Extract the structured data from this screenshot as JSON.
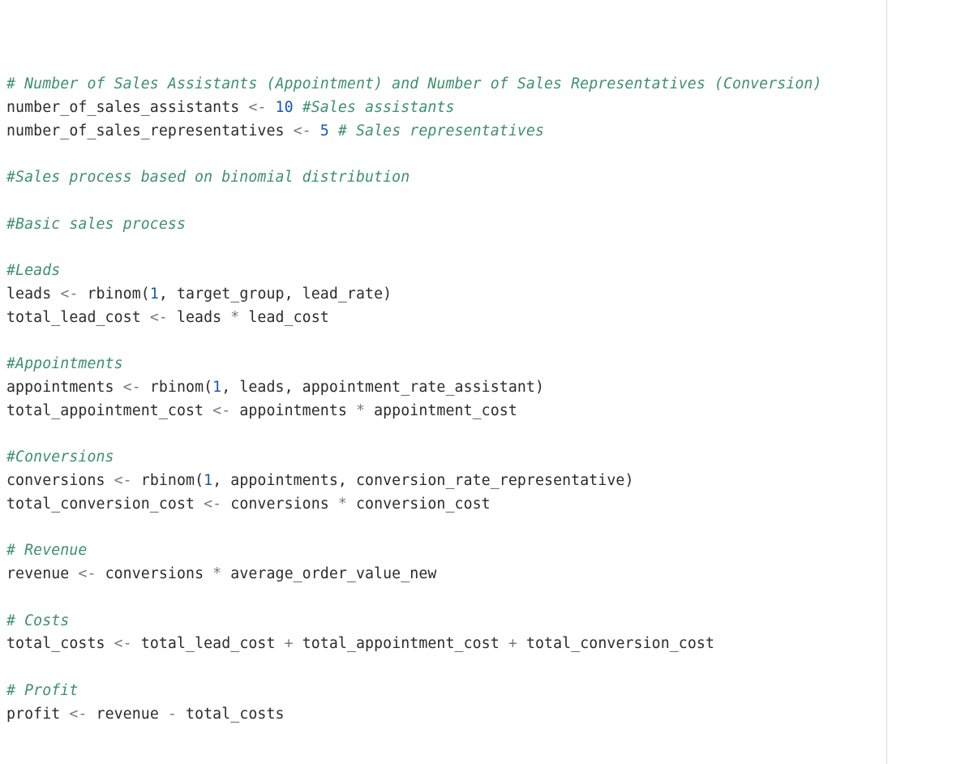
{
  "code": {
    "colors": {
      "comment": "#3d8f70",
      "operator": "#7a7a7a",
      "number": "#1357b4",
      "identifier": "#2b2b2b",
      "background": "#ffffff",
      "rule": "#d9d9d9"
    },
    "lines": [
      {
        "tokens": [
          {
            "t": "cm",
            "v": "# Number of Sales Assistants (Appointment) and Number of Sales Representatives (Conversion)"
          }
        ]
      },
      {
        "tokens": [
          {
            "t": "id",
            "v": "number_of_sales_assistants "
          },
          {
            "t": "op",
            "v": "<-"
          },
          {
            "t": "id",
            "v": " "
          },
          {
            "t": "num",
            "v": "10"
          },
          {
            "t": "id",
            "v": " "
          },
          {
            "t": "cm",
            "v": "#Sales assistants"
          }
        ]
      },
      {
        "tokens": [
          {
            "t": "id",
            "v": "number_of_sales_representatives "
          },
          {
            "t": "op",
            "v": "<-"
          },
          {
            "t": "id",
            "v": " "
          },
          {
            "t": "num",
            "v": "5"
          },
          {
            "t": "id",
            "v": " "
          },
          {
            "t": "cm",
            "v": "# Sales representatives"
          }
        ]
      },
      {
        "tokens": [
          {
            "t": "id",
            "v": ""
          }
        ]
      },
      {
        "tokens": [
          {
            "t": "cm",
            "v": "#Sales process based on binomial distribution"
          }
        ]
      },
      {
        "tokens": [
          {
            "t": "id",
            "v": ""
          }
        ]
      },
      {
        "tokens": [
          {
            "t": "cm",
            "v": "#Basic sales process"
          }
        ]
      },
      {
        "tokens": [
          {
            "t": "id",
            "v": ""
          }
        ]
      },
      {
        "tokens": [
          {
            "t": "cm",
            "v": "#Leads"
          }
        ]
      },
      {
        "tokens": [
          {
            "t": "id",
            "v": "leads "
          },
          {
            "t": "op",
            "v": "<-"
          },
          {
            "t": "id",
            "v": " rbinom("
          },
          {
            "t": "num",
            "v": "1"
          },
          {
            "t": "id",
            "v": ", target_group, lead_rate)"
          }
        ]
      },
      {
        "tokens": [
          {
            "t": "id",
            "v": "total_lead_cost "
          },
          {
            "t": "op",
            "v": "<-"
          },
          {
            "t": "id",
            "v": " leads "
          },
          {
            "t": "op",
            "v": "*"
          },
          {
            "t": "id",
            "v": " lead_cost"
          }
        ]
      },
      {
        "tokens": [
          {
            "t": "id",
            "v": ""
          }
        ]
      },
      {
        "tokens": [
          {
            "t": "cm",
            "v": "#Appointments"
          }
        ]
      },
      {
        "tokens": [
          {
            "t": "id",
            "v": "appointments "
          },
          {
            "t": "op",
            "v": "<-"
          },
          {
            "t": "id",
            "v": " rbinom("
          },
          {
            "t": "num",
            "v": "1"
          },
          {
            "t": "id",
            "v": ", leads, appointment_rate_assistant)"
          }
        ]
      },
      {
        "tokens": [
          {
            "t": "id",
            "v": "total_appointment_cost "
          },
          {
            "t": "op",
            "v": "<-"
          },
          {
            "t": "id",
            "v": " appointments "
          },
          {
            "t": "op",
            "v": "*"
          },
          {
            "t": "id",
            "v": " appointment_cost"
          }
        ]
      },
      {
        "tokens": [
          {
            "t": "id",
            "v": ""
          }
        ]
      },
      {
        "tokens": [
          {
            "t": "cm",
            "v": "#Conversions"
          }
        ]
      },
      {
        "tokens": [
          {
            "t": "id",
            "v": "conversions "
          },
          {
            "t": "op",
            "v": "<-"
          },
          {
            "t": "id",
            "v": " rbinom("
          },
          {
            "t": "num",
            "v": "1"
          },
          {
            "t": "id",
            "v": ", appointments, conversion_rate_representative)"
          }
        ]
      },
      {
        "tokens": [
          {
            "t": "id",
            "v": "total_conversion_cost "
          },
          {
            "t": "op",
            "v": "<-"
          },
          {
            "t": "id",
            "v": " conversions "
          },
          {
            "t": "op",
            "v": "*"
          },
          {
            "t": "id",
            "v": " conversion_cost"
          }
        ]
      },
      {
        "tokens": [
          {
            "t": "id",
            "v": ""
          }
        ]
      },
      {
        "tokens": [
          {
            "t": "cm",
            "v": "# Revenue"
          }
        ]
      },
      {
        "tokens": [
          {
            "t": "id",
            "v": "revenue "
          },
          {
            "t": "op",
            "v": "<-"
          },
          {
            "t": "id",
            "v": " conversions "
          },
          {
            "t": "op",
            "v": "*"
          },
          {
            "t": "id",
            "v": " average_order_value_new"
          }
        ]
      },
      {
        "tokens": [
          {
            "t": "id",
            "v": ""
          }
        ]
      },
      {
        "tokens": [
          {
            "t": "cm",
            "v": "# Costs"
          }
        ]
      },
      {
        "tokens": [
          {
            "t": "id",
            "v": "total_costs "
          },
          {
            "t": "op",
            "v": "<-"
          },
          {
            "t": "id",
            "v": " total_lead_cost "
          },
          {
            "t": "op",
            "v": "+"
          },
          {
            "t": "id",
            "v": " total_appointment_cost "
          },
          {
            "t": "op",
            "v": "+"
          },
          {
            "t": "id",
            "v": " total_conversion_cost"
          }
        ]
      },
      {
        "tokens": [
          {
            "t": "id",
            "v": ""
          }
        ]
      },
      {
        "tokens": [
          {
            "t": "cm",
            "v": "# Profit"
          }
        ]
      },
      {
        "tokens": [
          {
            "t": "id",
            "v": "profit "
          },
          {
            "t": "op",
            "v": "<-"
          },
          {
            "t": "id",
            "v": " revenue "
          },
          {
            "t": "op",
            "v": "-"
          },
          {
            "t": "id",
            "v": " total_costs"
          }
        ]
      }
    ]
  }
}
